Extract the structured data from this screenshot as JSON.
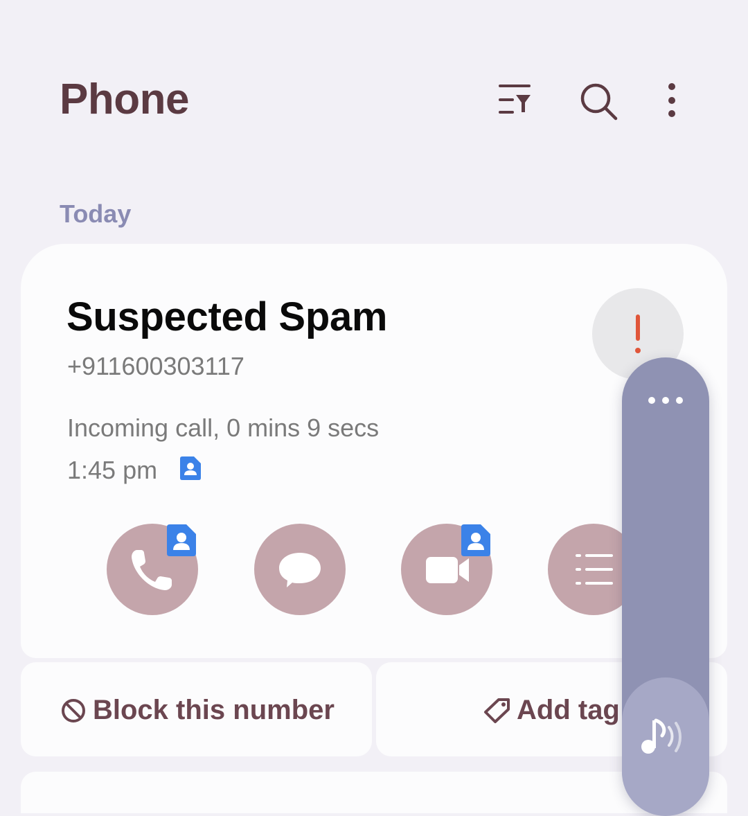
{
  "header": {
    "title": "Phone",
    "icons": [
      "filter-list-icon",
      "search-icon",
      "more-vertical-icon"
    ]
  },
  "section": {
    "label": "Today"
  },
  "call_card": {
    "caller_name": "Suspected Spam",
    "number": "+911600303117",
    "detail": "Incoming call, 0 mins 9 secs",
    "time": "1:45 pm",
    "spam_icon": "exclamation-icon",
    "actions": [
      {
        "name": "call",
        "icon": "phone-icon",
        "has_contact_badge": true
      },
      {
        "name": "message",
        "icon": "chat-bubble-icon",
        "has_contact_badge": false
      },
      {
        "name": "video-call",
        "icon": "video-camera-icon",
        "has_contact_badge": true
      },
      {
        "name": "details",
        "icon": "list-icon",
        "has_contact_badge": false
      }
    ]
  },
  "buttons": {
    "block_label": "Block this number",
    "tag_label": "Add tag"
  },
  "overlay": {
    "icons": [
      "more-horizontal-icon",
      "music-note-icon"
    ]
  },
  "colors": {
    "title": "#5b3a42",
    "section_label": "#8a8bb3",
    "action_button": "#c4a5ab",
    "badge_blue": "#3b82e8",
    "spam_red": "#e0563a",
    "overlay": "#8f92b3"
  }
}
